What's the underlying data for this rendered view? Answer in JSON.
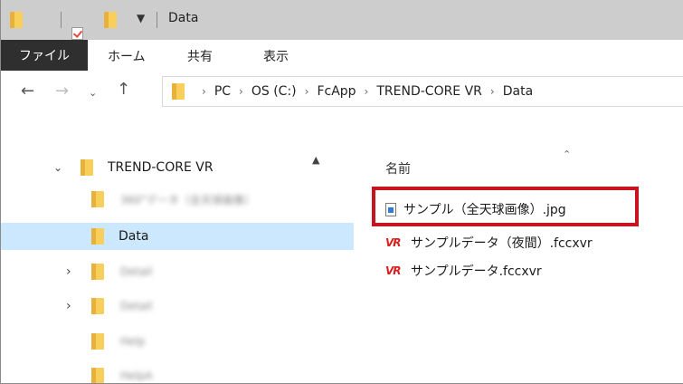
{
  "window": {
    "title": "Data"
  },
  "ribbon": {
    "tabs": [
      "ファイル",
      "ホーム",
      "共有",
      "表示"
    ]
  },
  "address": {
    "crumbs": [
      "PC",
      "OS (C:)",
      "FcApp",
      "TREND-CORE VR",
      "Data"
    ]
  },
  "tree": {
    "parent": "TREND-CORE VR",
    "items": [
      {
        "label": "360°データ（全天球画像）",
        "blurred": true
      },
      {
        "label": "Data",
        "selected": true
      },
      {
        "label": "Detail",
        "blurred": true,
        "expandable": true
      },
      {
        "label": "Detail",
        "blurred": true,
        "expandable": true
      },
      {
        "label": "Help",
        "blurred": true
      },
      {
        "label": "HelpA",
        "blurred": true
      }
    ]
  },
  "files": {
    "column_name": "名前",
    "items": [
      {
        "name": "サンプル（全天球画像）.jpg",
        "icon": "jpg-file-icon",
        "highlighted": true
      },
      {
        "name": "サンプルデータ（夜間）.fccxvr",
        "icon": "vr-file-icon"
      },
      {
        "name": "サンプルデータ.fccxvr",
        "icon": "vr-file-icon"
      }
    ]
  },
  "colors": {
    "highlight": "#c8141e",
    "selected": "#cce8ff",
    "titlebar": "#cdcdcd"
  }
}
